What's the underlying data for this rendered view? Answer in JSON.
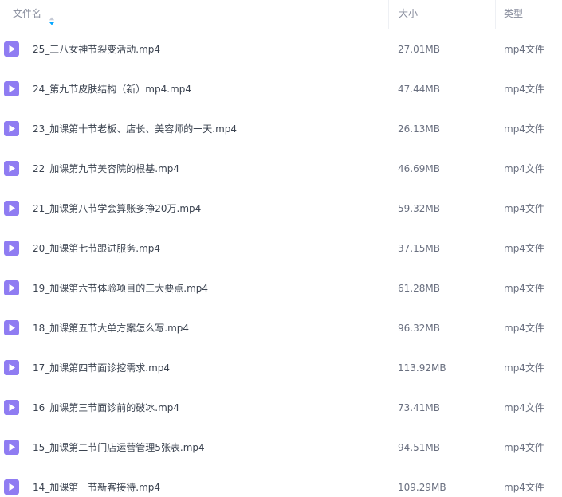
{
  "header": {
    "name_label": "文件名",
    "size_label": "大小",
    "type_label": "类型"
  },
  "colors": {
    "icon_purple": "#8f7cf2",
    "sort_blue": "#06a7ff",
    "header_text": "#878c9c",
    "row_text": "#3b4350"
  },
  "files": [
    {
      "name": "25_三八女神节裂变活动.mp4",
      "size": "27.01MB",
      "type": "mp4文件",
      "icon": "video-file-icon"
    },
    {
      "name": "24_第九节皮肤结构（新）mp4.mp4",
      "size": "47.44MB",
      "type": "mp4文件",
      "icon": "video-file-icon"
    },
    {
      "name": "23_加课第十节老板、店长、美容师的一天.mp4",
      "size": "26.13MB",
      "type": "mp4文件",
      "icon": "video-file-icon"
    },
    {
      "name": "22_加课第九节美容院的根基.mp4",
      "size": "46.69MB",
      "type": "mp4文件",
      "icon": "video-file-icon"
    },
    {
      "name": "21_加课第八节学会算账多挣20万.mp4",
      "size": "59.32MB",
      "type": "mp4文件",
      "icon": "video-file-icon"
    },
    {
      "name": "20_加课第七节跟进服务.mp4",
      "size": "37.15MB",
      "type": "mp4文件",
      "icon": "video-file-icon"
    },
    {
      "name": "19_加课第六节体验项目的三大要点.mp4",
      "size": "61.28MB",
      "type": "mp4文件",
      "icon": "video-file-icon"
    },
    {
      "name": "18_加课第五节大单方案怎么写.mp4",
      "size": "96.32MB",
      "type": "mp4文件",
      "icon": "video-file-icon"
    },
    {
      "name": "17_加课第四节面诊挖需求.mp4",
      "size": "113.92MB",
      "type": "mp4文件",
      "icon": "video-file-icon"
    },
    {
      "name": "16_加课第三节面诊前的破冰.mp4",
      "size": "73.41MB",
      "type": "mp4文件",
      "icon": "video-file-icon"
    },
    {
      "name": "15_加课第二节门店运营管理5张表.mp4",
      "size": "94.51MB",
      "type": "mp4文件",
      "icon": "video-file-icon"
    },
    {
      "name": "14_加课第一节新客接待.mp4",
      "size": "109.29MB",
      "type": "mp4文件",
      "icon": "video-file-icon"
    }
  ]
}
